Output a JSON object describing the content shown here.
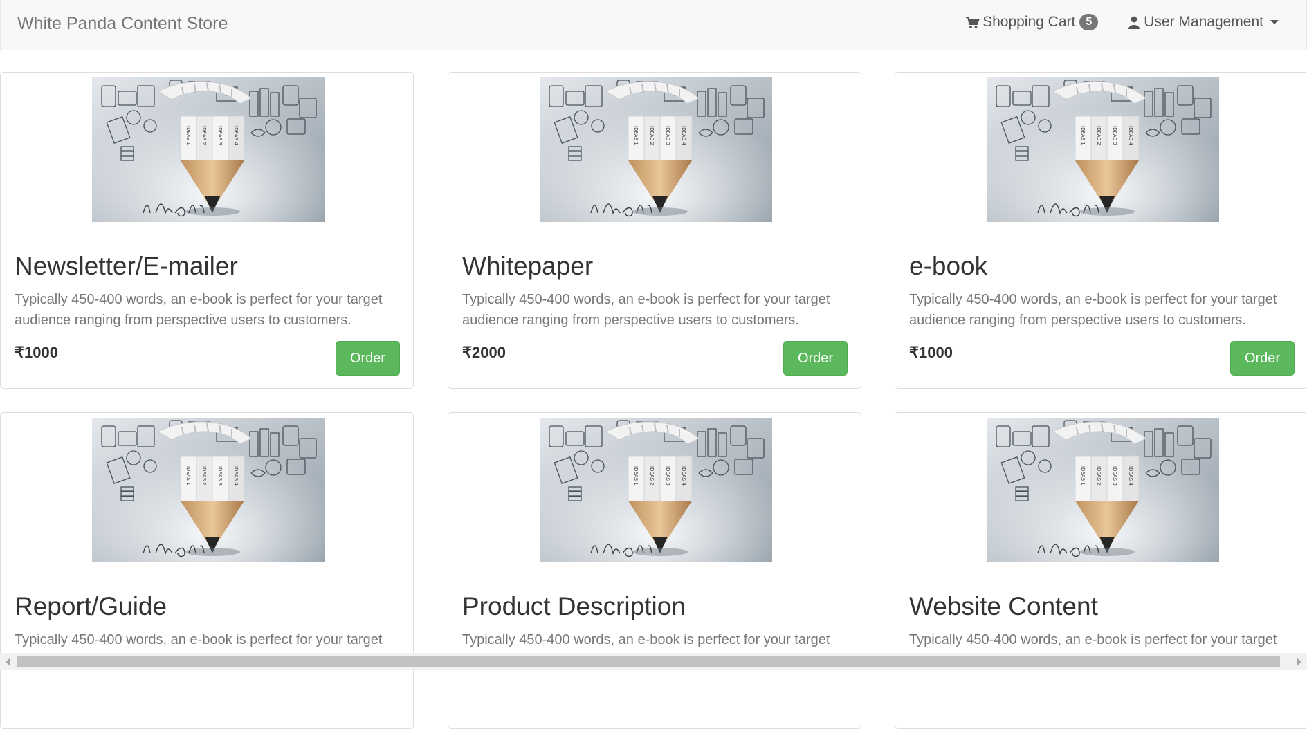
{
  "navbar": {
    "brand": "White Panda Content Store",
    "cart": {
      "icon": "shopping-cart-icon",
      "label": "Shopping Cart",
      "count": "5"
    },
    "user_menu": {
      "icon": "user-icon",
      "label": "User Management"
    }
  },
  "products": [
    {
      "title": "Newsletter/E-mailer",
      "description": "Typically 450-400 words, an e-book is perfect for your target audience ranging from perspective users to customers.",
      "price": "₹1000",
      "order_label": "Order"
    },
    {
      "title": "Whitepaper",
      "description": "Typically 450-400 words, an e-book is perfect for your target audience ranging from perspective users to customers.",
      "price": "₹2000",
      "order_label": "Order"
    },
    {
      "title": "e-book",
      "description": "Typically 450-400 words, an e-book is perfect for your target audience ranging from perspective users to customers.",
      "price": "₹1000",
      "order_label": "Order"
    },
    {
      "title": "Report/Guide",
      "description": "Typically 450-400 words, an e-book is perfect for your target audience ranging from perspective users to customers."
    },
    {
      "title": "Product Description",
      "description": "Typically 450-400 words, an e-book is perfect for your target audience ranging from perspective users to customers."
    },
    {
      "title": "Website Content",
      "description": "Typically 450-400 words, an e-book is perfect for your target audience ranging from perspective users to customers."
    }
  ],
  "image": {
    "pencil_labels": [
      "IDEAS 1",
      "IDEAS 2",
      "IDEAS 3",
      "IDEAS 4"
    ],
    "script_text": "idea"
  },
  "colors": {
    "order_button": "#5cb85c",
    "badge": "#777777",
    "navbar_bg": "#f8f8f8"
  }
}
